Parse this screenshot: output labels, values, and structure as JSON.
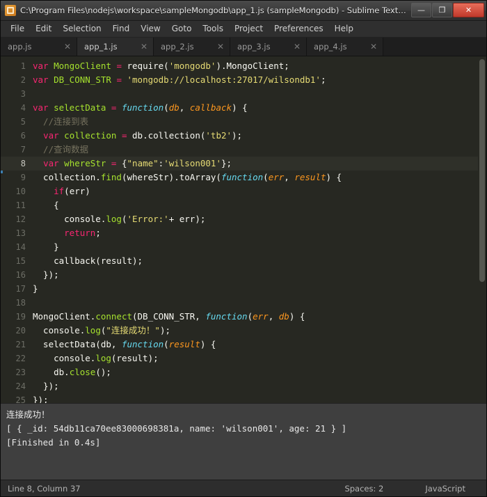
{
  "window": {
    "title": "C:\\Program Files\\nodejs\\workspace\\sampleMongodb\\app_1.js (sampleMongodb) - Sublime Text…",
    "icon": "sublime-text-icon",
    "buttons": {
      "minimize": "—",
      "maximize": "❐",
      "close": "✕"
    }
  },
  "menu": {
    "items": [
      "File",
      "Edit",
      "Selection",
      "Find",
      "View",
      "Goto",
      "Tools",
      "Project",
      "Preferences",
      "Help"
    ]
  },
  "tabs": [
    {
      "label": "app.js",
      "active": false,
      "close": "✕"
    },
    {
      "label": "app_1.js",
      "active": true,
      "close": "✕"
    },
    {
      "label": "app_2.js",
      "active": false,
      "close": "✕"
    },
    {
      "label": "app_3.js",
      "active": false,
      "close": "✕"
    },
    {
      "label": "app_4.js",
      "active": false,
      "close": "✕"
    }
  ],
  "editor": {
    "line_numbers": [
      "1",
      "2",
      "3",
      "4",
      "5",
      "6",
      "7",
      "8",
      "9",
      "10",
      "11",
      "12",
      "13",
      "14",
      "15",
      "16",
      "17",
      "18",
      "19",
      "20",
      "21",
      "22",
      "23",
      "24",
      "25"
    ],
    "highlighted_line": 8,
    "lines": [
      "var MongoClient = require('mongodb').MongoClient;",
      "var DB_CONN_STR = 'mongodb://localhost:27017/wilsondb1';",
      "",
      "var selectData = function(db, callback) {",
      "  //连接到表",
      "  var collection = db.collection('tb2');",
      "  //查询数据",
      "  var whereStr = {\"name\":'wilson001'};",
      "  collection.find(whereStr).toArray(function(err, result) {",
      "    if(err)",
      "    {",
      "      console.log('Error:'+ err);",
      "      return;",
      "    }",
      "    callback(result);",
      "  });",
      "}",
      "",
      "MongoClient.connect(DB_CONN_STR, function(err, db) {",
      "  console.log(\"连接成功！\");",
      "  selectData(db, function(result) {",
      "    console.log(result);",
      "    db.close();",
      "  });",
      "});"
    ]
  },
  "console": {
    "lines": [
      "连接成功！",
      "[ { _id: 54db11ca70ee83000698381a, name: 'wilson001', age: 21 } ]",
      "[Finished in 0.4s]"
    ]
  },
  "statusbar": {
    "cursor": "Line 8, Column 37",
    "indent": "Spaces: 2",
    "syntax": "JavaScript"
  },
  "colors": {
    "editor_bg": "#272822",
    "keyword": "#f92672",
    "string": "#e6db74",
    "comment": "#75715e",
    "function": "#66d9ef",
    "identifier": "#a6e22e",
    "param": "#fd971f",
    "close_button": "#c0392b"
  }
}
